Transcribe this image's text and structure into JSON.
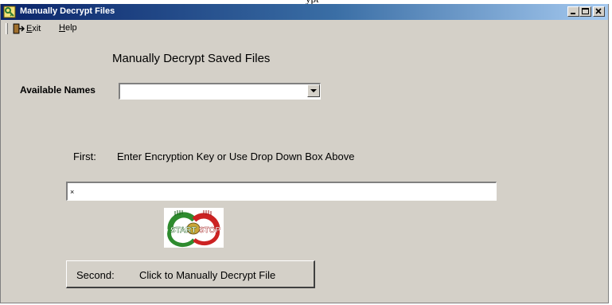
{
  "window": {
    "title": "Manually Decrypt Files",
    "background_title_fragment": "ypt"
  },
  "menu": {
    "exit": {
      "prefix": "E",
      "rest": "xit"
    },
    "help": {
      "prefix": "H",
      "rest": "elp"
    }
  },
  "heading": "Manually Decrypt Saved Files",
  "names": {
    "label": "Available Names",
    "value": ""
  },
  "step1": {
    "label": "First:",
    "text": "Enter Encryption Key or Use Drop Down Box Above"
  },
  "key_input": {
    "value": "×"
  },
  "logo": {
    "text_left": "START",
    "text_right": "STOP",
    "colors": {
      "green": "#2e8b2e",
      "red": "#cc2222",
      "gold": "#c9a437"
    }
  },
  "step2": {
    "label": "Second:",
    "text": "Click to Manually Decrypt File"
  },
  "colors": {
    "face": "#d4d0c8",
    "title_start": "#0a246a",
    "title_end": "#a6caf0"
  }
}
